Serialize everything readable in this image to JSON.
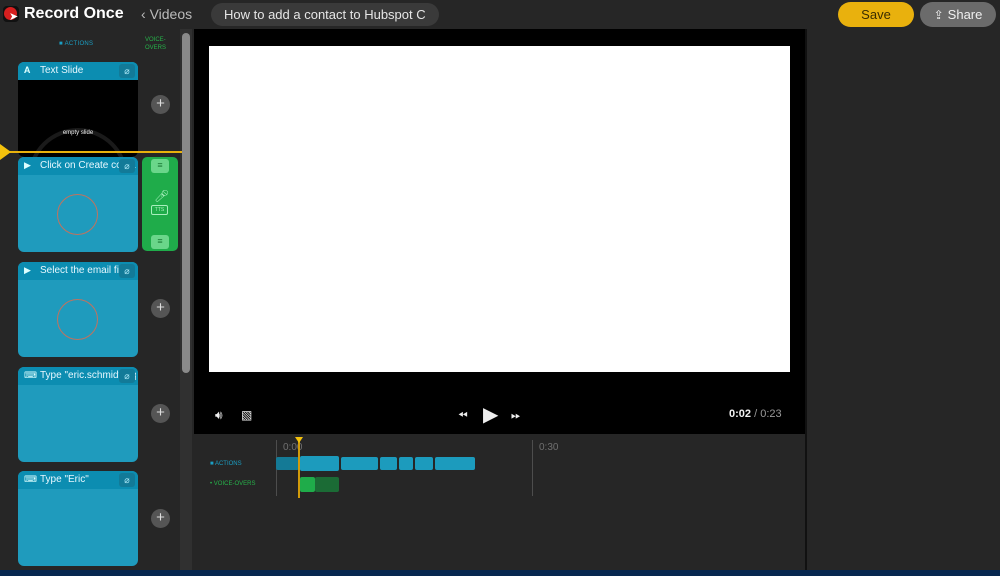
{
  "app": {
    "brand": "Record Once",
    "back_label": "Videos",
    "video_title": "How to add a contact to Hubspot C",
    "save_label": "Save",
    "share_label": "Share"
  },
  "sidebar": {
    "actions_header": "ACTIONS",
    "voiceovers_header_1": "VOICE-",
    "voiceovers_header_2": "OVERS",
    "cards": [
      {
        "icon": "text-slide-icon",
        "label": "Text Slide",
        "preview_text": "empty slide",
        "type": "text"
      },
      {
        "icon": "cursor-icon",
        "label": "Click on Create contac",
        "type": "click"
      },
      {
        "icon": "cursor-icon",
        "label": "Select the email field",
        "type": "click"
      },
      {
        "icon": "keyboard-icon",
        "label": "Type \"eric.schmidt@gc",
        "type": "type"
      },
      {
        "icon": "keyboard-icon",
        "label": "Type \"Eric\"",
        "type": "type"
      }
    ],
    "add_symbol": "+"
  },
  "player": {
    "current_time": "0:02",
    "separator": " / ",
    "total_time": "0:23"
  },
  "timeline": {
    "actions_label": "ACTIONS",
    "voiceovers_label": "VOICE-OVERS",
    "ticks": [
      "0:00",
      "0:30"
    ],
    "colors": {
      "action": "#1c9bbd",
      "voiceover_active": "#1fac4a",
      "voiceover_dim": "#1b6b35",
      "playhead": "#f4c20d"
    }
  }
}
